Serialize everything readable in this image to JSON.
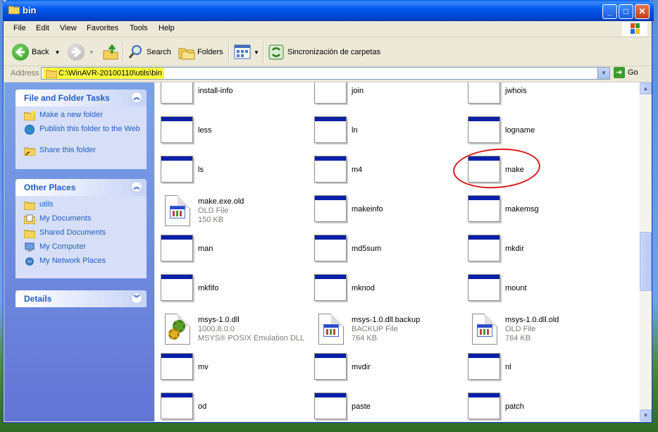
{
  "window": {
    "title": "bin"
  },
  "menu": [
    "File",
    "Edit",
    "View",
    "Favorites",
    "Tools",
    "Help"
  ],
  "toolbar": {
    "back_label": "Back",
    "search_label": "Search",
    "folders_label": "Folders",
    "sync_label": "Sincronización de carpetas"
  },
  "address": {
    "label": "Address",
    "value": "C:\\WinAVR-20100110\\utils\\bin",
    "go_label": "Go"
  },
  "tasks_panel": {
    "title": "File and Folder Tasks",
    "items": [
      "Make a new folder",
      "Publish this folder to the Web",
      "Share this folder"
    ]
  },
  "places_panel": {
    "title": "Other Places",
    "items": [
      "utils",
      "My Documents",
      "Shared Documents",
      "My Computer",
      "My Network Places"
    ]
  },
  "details_panel": {
    "title": "Details"
  },
  "files": [
    {
      "name": "install-info",
      "type": "exe"
    },
    {
      "name": "join",
      "type": "exe"
    },
    {
      "name": "jwhois",
      "type": "exe"
    },
    {
      "name": "less",
      "type": "exe"
    },
    {
      "name": "ln",
      "type": "exe"
    },
    {
      "name": "logname",
      "type": "exe"
    },
    {
      "name": "ls",
      "type": "exe"
    },
    {
      "name": "m4",
      "type": "exe"
    },
    {
      "name": "make",
      "type": "exe"
    },
    {
      "name": "make.exe.old",
      "type": "doc",
      "sub1": "OLD File",
      "sub2": "150 KB"
    },
    {
      "name": "makeinfo",
      "type": "exe"
    },
    {
      "name": "makemsg",
      "type": "exe"
    },
    {
      "name": "man",
      "type": "exe"
    },
    {
      "name": "md5sum",
      "type": "exe"
    },
    {
      "name": "mkdir",
      "type": "exe"
    },
    {
      "name": "mkfifo",
      "type": "exe"
    },
    {
      "name": "mknod",
      "type": "exe"
    },
    {
      "name": "mount",
      "type": "exe"
    },
    {
      "name": "msys-1.0.dll",
      "type": "dll",
      "sub1": "1000.8.0.0",
      "sub2": "MSYS® POSIX Emulation DLL"
    },
    {
      "name": "msys-1.0.dll.backup",
      "type": "doc",
      "sub1": "BACKUP File",
      "sub2": "764 KB"
    },
    {
      "name": "msys-1.0.dll.old",
      "type": "doc",
      "sub1": "OLD File",
      "sub2": "764 KB"
    },
    {
      "name": "mv",
      "type": "exe"
    },
    {
      "name": "mvdir",
      "type": "exe"
    },
    {
      "name": "nl",
      "type": "exe"
    },
    {
      "name": "od",
      "type": "exe"
    },
    {
      "name": "paste",
      "type": "exe"
    },
    {
      "name": "patch",
      "type": "exe"
    }
  ]
}
